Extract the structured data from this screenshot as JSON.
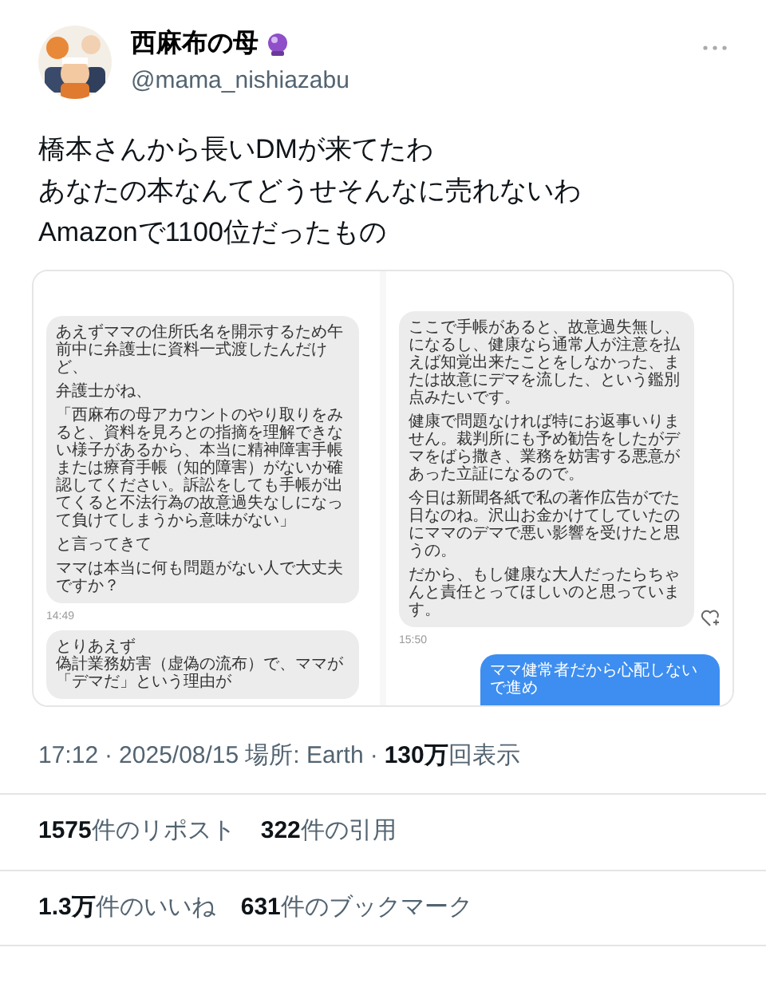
{
  "author": {
    "name": "西麻布の母",
    "handle": "@mama_nishiazabu"
  },
  "text_lines": [
    "橋本さんから長いDMが来てたわ",
    "あなたの本なんてどうせそんなに売れないわ",
    "Amazonで1100位だったもの"
  ],
  "image_panels": [
    {
      "items": [
        {
          "kind": "received",
          "paragraphs": [
            "あえずママの住所氏名を開示するため午前中に弁護士に資料一式渡したんだけど、",
            "弁護士がね、",
            "「西麻布の母アカウントのやり取りをみると、資料を見ろとの指摘を理解できない様子があるから、本当に精神障害手帳または療育手帳（知的障害）がないか確認してください。訴訟をしても手帳が出てくると不法行為の故意過失なしになって負けてしまうから意味がない」",
            "と言ってきて",
            "ママは本当に何も問題がない人で大丈夫ですか？"
          ],
          "like_button": false
        },
        {
          "kind": "time",
          "text": "14:49"
        },
        {
          "kind": "received",
          "paragraphs": [
            [
              "とりあえず",
              "偽計業務妨害（虚偽の流布）で、ママが「デマだ」という理由が"
            ]
          ],
          "like_button": false
        }
      ]
    },
    {
      "items": [
        {
          "kind": "received",
          "paragraphs": [
            "ここで手帳があると、故意過失無し、になるし、健康なら通常人が注意を払えば知覚出来たことをしなかった、または故意にデマを流した、という鑑別点みたいです。",
            "健康で問題なければ特にお返事いりません。裁判所にも予め勧告をしたがデマをばら撒き、業務を妨害する悪意があった立証になるので。",
            "今日は新聞各紙で私の著作広告がでた日なのね。沢山お金かけてしていたのにママのデマで悪い影響を受けたと思うの。",
            "だから、もし健康な大人だったらちゃんと責任とってほしいのと思っています。"
          ],
          "like_button": true
        },
        {
          "kind": "time",
          "text": "15:50"
        },
        {
          "kind": "sent",
          "paragraphs": [
            "ママ健常者だから心配しないで進め"
          ],
          "like_button": false
        }
      ]
    }
  ],
  "meta": {
    "separator": "·",
    "time": "17:12",
    "date": "2025/08/15",
    "location": "場所: Earth",
    "views": "130万",
    "views_label": "回表示"
  },
  "stats": [
    [
      {
        "count": "1575",
        "label": "件のリポスト"
      },
      {
        "count": "322",
        "label": "件の引用"
      }
    ],
    [
      {
        "count": "1.3万",
        "label": "件のいいね"
      },
      {
        "count": "631",
        "label": "件のブックマーク"
      }
    ]
  ]
}
